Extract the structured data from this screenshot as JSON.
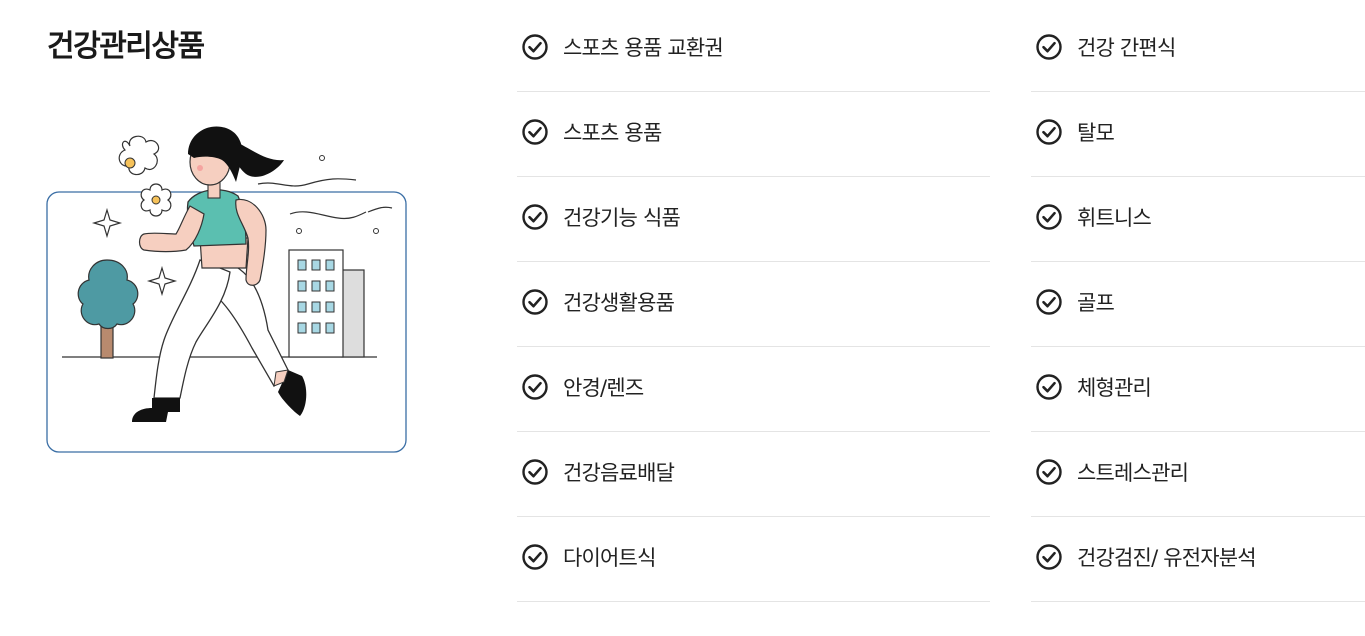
{
  "section": {
    "title": "건강관리상품"
  },
  "categories": {
    "left": [
      {
        "label": "스포츠 용품 교환권",
        "icon": "check-circle-icon"
      },
      {
        "label": "스포츠 용품",
        "icon": "check-circle-icon"
      },
      {
        "label": "건강기능 식품",
        "icon": "check-circle-icon"
      },
      {
        "label": "건강생활용품",
        "icon": "check-circle-icon"
      },
      {
        "label": "안경/렌즈",
        "icon": "check-circle-icon"
      },
      {
        "label": "건강음료배달",
        "icon": "check-circle-icon"
      },
      {
        "label": "다이어트식",
        "icon": "check-circle-icon"
      }
    ],
    "right": [
      {
        "label": "건강 간편식",
        "icon": "check-circle-icon"
      },
      {
        "label": "탈모",
        "icon": "check-circle-icon"
      },
      {
        "label": "휘트니스",
        "icon": "check-circle-icon"
      },
      {
        "label": "골프",
        "icon": "check-circle-icon"
      },
      {
        "label": "체형관리",
        "icon": "check-circle-icon"
      },
      {
        "label": "스트레스관리",
        "icon": "check-circle-icon"
      },
      {
        "label": "건강검진/ 유전자분석",
        "icon": "check-circle-icon"
      }
    ]
  },
  "colors": {
    "text": "#222222",
    "divider": "#e4e4e4",
    "accent_teal": "#5bbfb0",
    "tree_teal": "#4e9aa3",
    "frame_border": "#3a6ea5"
  }
}
